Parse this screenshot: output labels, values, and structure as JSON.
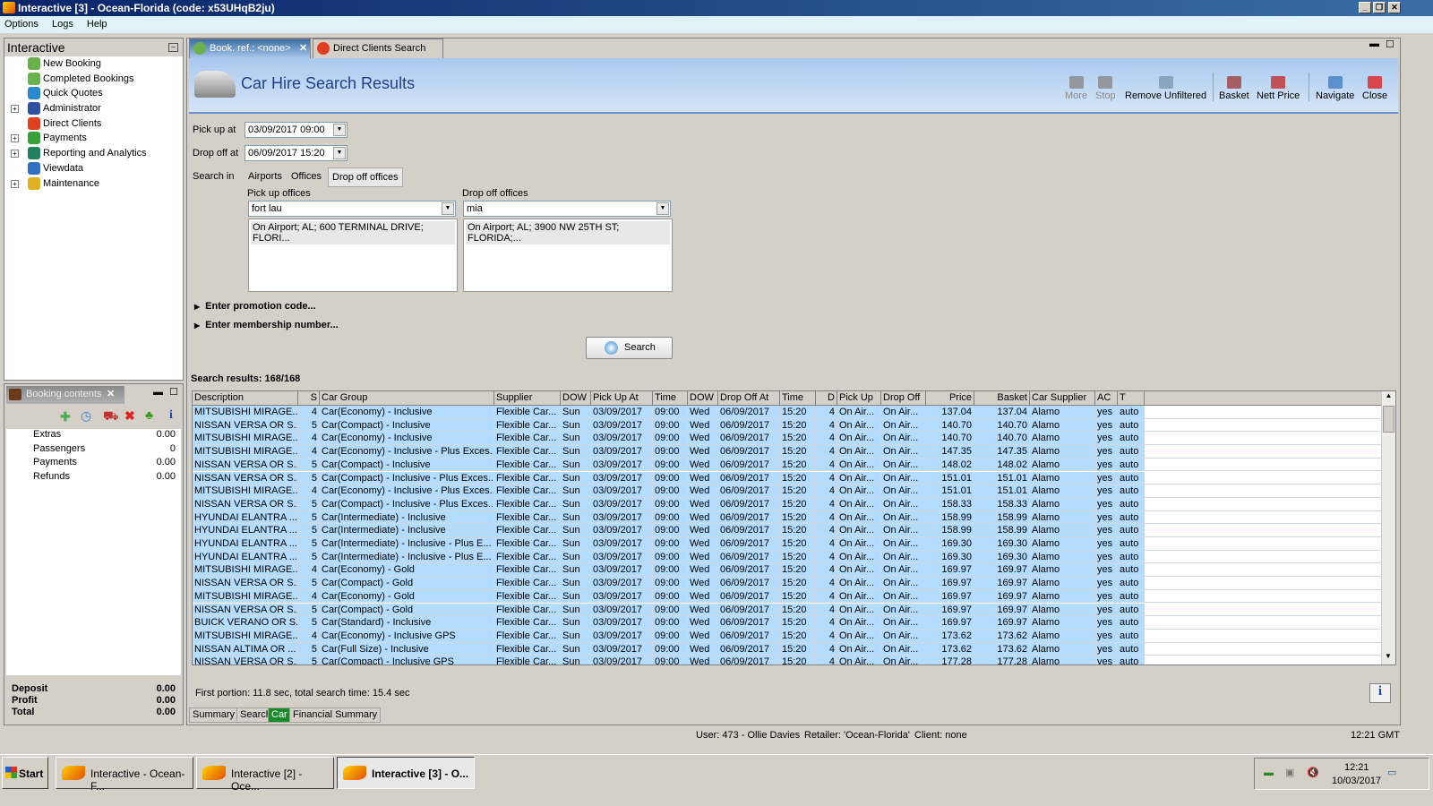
{
  "window": {
    "title": "Interactive [3] - Ocean-Florida (code: x53UHqB2ju)"
  },
  "menu": [
    "Options",
    "Logs",
    "Help"
  ],
  "nav": {
    "title": "Interactive",
    "items": [
      {
        "label": "New Booking",
        "icon": "palm-tree-icon",
        "expand": false
      },
      {
        "label": "Completed Bookings",
        "icon": "palm-tree-icon",
        "expand": false
      },
      {
        "label": "Quick Quotes",
        "icon": "clock-icon",
        "expand": false
      },
      {
        "label": "Administrator",
        "icon": "admin-icon",
        "expand": true
      },
      {
        "label": "Direct Clients",
        "icon": "client-icon",
        "expand": false
      },
      {
        "label": "Payments",
        "icon": "payments-icon",
        "expand": true
      },
      {
        "label": "Reporting and Analytics",
        "icon": "report-icon",
        "expand": true
      },
      {
        "label": "Viewdata",
        "icon": "globe-icon",
        "expand": false
      },
      {
        "label": "Maintenance",
        "icon": "maintenance-icon",
        "expand": true
      }
    ]
  },
  "booking": {
    "title": "Booking contents",
    "items": [
      {
        "label": "Extras",
        "value": "0.00"
      },
      {
        "label": "Passengers",
        "value": "0"
      },
      {
        "label": "Payments",
        "value": "0.00"
      },
      {
        "label": "Refunds",
        "value": "0.00"
      }
    ],
    "totals": [
      {
        "label": "Deposit",
        "value": "0.00"
      },
      {
        "label": "Profit",
        "value": "0.00"
      },
      {
        "label": "Total",
        "value": "0.00"
      }
    ]
  },
  "tabs": [
    {
      "label": "Book. ref.: <none>",
      "active": true
    },
    {
      "label": "Direct Clients Search",
      "active": false
    }
  ],
  "page": {
    "title": "Car Hire Search Results"
  },
  "toolbar": [
    {
      "label": "More",
      "icon": "triangle-down-icon",
      "enabled": false
    },
    {
      "label": "Stop",
      "icon": "stop-icon",
      "enabled": false
    },
    {
      "label": "Remove Unfiltered",
      "icon": "bin-remove-icon",
      "enabled": true
    },
    {
      "label": "Basket",
      "icon": "basket-icon",
      "enabled": true
    },
    {
      "label": "Nett Price",
      "icon": "nett-price-icon",
      "enabled": true
    },
    {
      "label": "Navigate",
      "icon": "compass-icon",
      "enabled": true
    },
    {
      "label": "Close",
      "icon": "close-icon",
      "enabled": true
    }
  ],
  "form": {
    "pickup_label": "Pick up at",
    "pickup_value": "03/09/2017 09:00",
    "dropoff_label": "Drop off at",
    "dropoff_value": "06/09/2017 15:20",
    "search_in_label": "Search in",
    "search_in_options": [
      "Airports",
      "Offices",
      "Drop off offices"
    ],
    "search_in_selected": "Drop off offices",
    "pu_offices_label": "Pick up offices",
    "pu_offices_value": "fort lau",
    "pu_offices_item": "On Airport; AL; 600 TERMINAL DRIVE; FLORI...",
    "do_offices_label": "Drop off offices",
    "do_offices_value": "mia",
    "do_offices_item": "On Airport; AL; 3900 NW 25TH ST; FLORIDA;...",
    "promo": "Enter promotion code...",
    "membership": "Enter membership number...",
    "search_button": "Search"
  },
  "results": {
    "summary": "Search results: 168/168",
    "columns": [
      "Description",
      "S",
      "Car Group",
      "Supplier",
      "DOW",
      "Pick Up At",
      "Time",
      "DOW",
      "Drop Off At",
      "Time",
      "D",
      "Pick Up",
      "Drop Off",
      "Price",
      "Basket",
      "Car Supplier",
      "AC",
      "T"
    ],
    "rows": [
      [
        "MITSUBISHI MIRAGE...",
        "4",
        "Car(Economy) - Inclusive",
        "Flexible Car...",
        "Sun",
        "03/09/2017",
        "09:00",
        "Wed",
        "06/09/2017",
        "15:20",
        "4",
        "On Air...",
        "On Air...",
        "137.04",
        "137.04",
        "Alamo",
        "yes",
        "auto"
      ],
      [
        "NISSAN VERSA OR S...",
        "5",
        "Car(Compact) - Inclusive",
        "Flexible Car...",
        "Sun",
        "03/09/2017",
        "09:00",
        "Wed",
        "06/09/2017",
        "15:20",
        "4",
        "On Air...",
        "On Air...",
        "140.70",
        "140.70",
        "Alamo",
        "yes",
        "auto"
      ],
      [
        "MITSUBISHI MIRAGE...",
        "4",
        "Car(Economy) - Inclusive",
        "Flexible Car...",
        "Sun",
        "03/09/2017",
        "09:00",
        "Wed",
        "06/09/2017",
        "15:20",
        "4",
        "On Air...",
        "On Air...",
        "140.70",
        "140.70",
        "Alamo",
        "yes",
        "auto"
      ],
      [
        "MITSUBISHI MIRAGE...",
        "4",
        "Car(Economy) - Inclusive - Plus Exces...",
        "Flexible Car...",
        "Sun",
        "03/09/2017",
        "09:00",
        "Wed",
        "06/09/2017",
        "15:20",
        "4",
        "On Air...",
        "On Air...",
        "147.35",
        "147.35",
        "Alamo",
        "yes",
        "auto"
      ],
      [
        "NISSAN VERSA OR S...",
        "5",
        "Car(Compact) - Inclusive",
        "Flexible Car...",
        "Sun",
        "03/09/2017",
        "09:00",
        "Wed",
        "06/09/2017",
        "15:20",
        "4",
        "On Air...",
        "On Air...",
        "148.02",
        "148.02",
        "Alamo",
        "yes",
        "auto"
      ],
      [
        "NISSAN VERSA OR S...",
        "5",
        "Car(Compact) - Inclusive - Plus Exces...",
        "Flexible Car...",
        "Sun",
        "03/09/2017",
        "09:00",
        "Wed",
        "06/09/2017",
        "15:20",
        "4",
        "On Air...",
        "On Air...",
        "151.01",
        "151.01",
        "Alamo",
        "yes",
        "auto"
      ],
      [
        "MITSUBISHI MIRAGE...",
        "4",
        "Car(Economy) - Inclusive - Plus Exces...",
        "Flexible Car...",
        "Sun",
        "03/09/2017",
        "09:00",
        "Wed",
        "06/09/2017",
        "15:20",
        "4",
        "On Air...",
        "On Air...",
        "151.01",
        "151.01",
        "Alamo",
        "yes",
        "auto"
      ],
      [
        "NISSAN VERSA OR S...",
        "5",
        "Car(Compact) - Inclusive - Plus Exces...",
        "Flexible Car...",
        "Sun",
        "03/09/2017",
        "09:00",
        "Wed",
        "06/09/2017",
        "15:20",
        "4",
        "On Air...",
        "On Air...",
        "158.33",
        "158.33",
        "Alamo",
        "yes",
        "auto"
      ],
      [
        "HYUNDAI ELANTRA ...",
        "5",
        "Car(Intermediate) - Inclusive",
        "Flexible Car...",
        "Sun",
        "03/09/2017",
        "09:00",
        "Wed",
        "06/09/2017",
        "15:20",
        "4",
        "On Air...",
        "On Air...",
        "158.99",
        "158.99",
        "Alamo",
        "yes",
        "auto"
      ],
      [
        "HYUNDAI ELANTRA ...",
        "5",
        "Car(Intermediate) - Inclusive",
        "Flexible Car...",
        "Sun",
        "03/09/2017",
        "09:00",
        "Wed",
        "06/09/2017",
        "15:20",
        "4",
        "On Air...",
        "On Air...",
        "158.99",
        "158.99",
        "Alamo",
        "yes",
        "auto"
      ],
      [
        "HYUNDAI ELANTRA ...",
        "5",
        "Car(Intermediate) - Inclusive - Plus E...",
        "Flexible Car...",
        "Sun",
        "03/09/2017",
        "09:00",
        "Wed",
        "06/09/2017",
        "15:20",
        "4",
        "On Air...",
        "On Air...",
        "169.30",
        "169.30",
        "Alamo",
        "yes",
        "auto"
      ],
      [
        "HYUNDAI ELANTRA ...",
        "5",
        "Car(Intermediate) - Inclusive - Plus E...",
        "Flexible Car...",
        "Sun",
        "03/09/2017",
        "09:00",
        "Wed",
        "06/09/2017",
        "15:20",
        "4",
        "On Air...",
        "On Air...",
        "169.30",
        "169.30",
        "Alamo",
        "yes",
        "auto"
      ],
      [
        "MITSUBISHI MIRAGE...",
        "4",
        "Car(Economy) - Gold",
        "Flexible Car...",
        "Sun",
        "03/09/2017",
        "09:00",
        "Wed",
        "06/09/2017",
        "15:20",
        "4",
        "On Air...",
        "On Air...",
        "169.97",
        "169.97",
        "Alamo",
        "yes",
        "auto"
      ],
      [
        "NISSAN VERSA OR S...",
        "5",
        "Car(Compact) - Gold",
        "Flexible Car...",
        "Sun",
        "03/09/2017",
        "09:00",
        "Wed",
        "06/09/2017",
        "15:20",
        "4",
        "On Air...",
        "On Air...",
        "169.97",
        "169.97",
        "Alamo",
        "yes",
        "auto"
      ],
      [
        "MITSUBISHI MIRAGE...",
        "4",
        "Car(Economy) - Gold",
        "Flexible Car...",
        "Sun",
        "03/09/2017",
        "09:00",
        "Wed",
        "06/09/2017",
        "15:20",
        "4",
        "On Air...",
        "On Air...",
        "169.97",
        "169.97",
        "Alamo",
        "yes",
        "auto"
      ],
      [
        "NISSAN VERSA OR S...",
        "5",
        "Car(Compact) - Gold",
        "Flexible Car...",
        "Sun",
        "03/09/2017",
        "09:00",
        "Wed",
        "06/09/2017",
        "15:20",
        "4",
        "On Air...",
        "On Air...",
        "169.97",
        "169.97",
        "Alamo",
        "yes",
        "auto"
      ],
      [
        "BUICK VERANO OR S...",
        "5",
        "Car(Standard) - Inclusive",
        "Flexible Car...",
        "Sun",
        "03/09/2017",
        "09:00",
        "Wed",
        "06/09/2017",
        "15:20",
        "4",
        "On Air...",
        "On Air...",
        "169.97",
        "169.97",
        "Alamo",
        "yes",
        "auto"
      ],
      [
        "MITSUBISHI MIRAGE...",
        "4",
        "Car(Economy) - Inclusive GPS",
        "Flexible Car...",
        "Sun",
        "03/09/2017",
        "09:00",
        "Wed",
        "06/09/2017",
        "15:20",
        "4",
        "On Air...",
        "On Air...",
        "173.62",
        "173.62",
        "Alamo",
        "yes",
        "auto"
      ],
      [
        "NISSAN ALTIMA OR ...",
        "5",
        "Car(Full Size) - Inclusive",
        "Flexible Car...",
        "Sun",
        "03/09/2017",
        "09:00",
        "Wed",
        "06/09/2017",
        "15:20",
        "4",
        "On Air...",
        "On Air...",
        "173.62",
        "173.62",
        "Alamo",
        "yes",
        "auto"
      ],
      [
        "NISSAN VERSA OR S...",
        "5",
        "Car(Compact) - Inclusive GPS",
        "Flexible Car...",
        "Sun",
        "03/09/2017",
        "09:00",
        "Wed",
        "06/09/2017",
        "15:20",
        "4",
        "On Air...",
        "On Air...",
        "177.28",
        "177.28",
        "Alamo",
        "yes",
        "auto"
      ]
    ],
    "timing": "First portion: 11.8 sec, total search time: 15.4 sec"
  },
  "bottom_tabs": [
    {
      "label": "Summary",
      "active": false
    },
    {
      "label": "Search",
      "active": false
    },
    {
      "label": "Car",
      "active": true
    },
    {
      "label": "Financial Summary",
      "active": false
    }
  ],
  "status": {
    "user": "User: 473 - Ollie Davies",
    "retailer": "Retailer: 'Ocean-Florida'",
    "client": "Client: none",
    "time": "12:21 GMT"
  },
  "taskbar": {
    "start": "Start",
    "items": [
      {
        "label": "Interactive - Ocean-F...",
        "active": false
      },
      {
        "label": "Interactive [2] - Oce...",
        "active": false
      },
      {
        "label": "Interactive [3] - O...",
        "active": true
      }
    ],
    "clock_time": "12:21",
    "clock_date": "10/03/2017"
  },
  "colors": {
    "row_selected": "#b3dcff",
    "title_accent": "#1f3f8f",
    "active_bottom_tab": "#1a8a2a"
  }
}
